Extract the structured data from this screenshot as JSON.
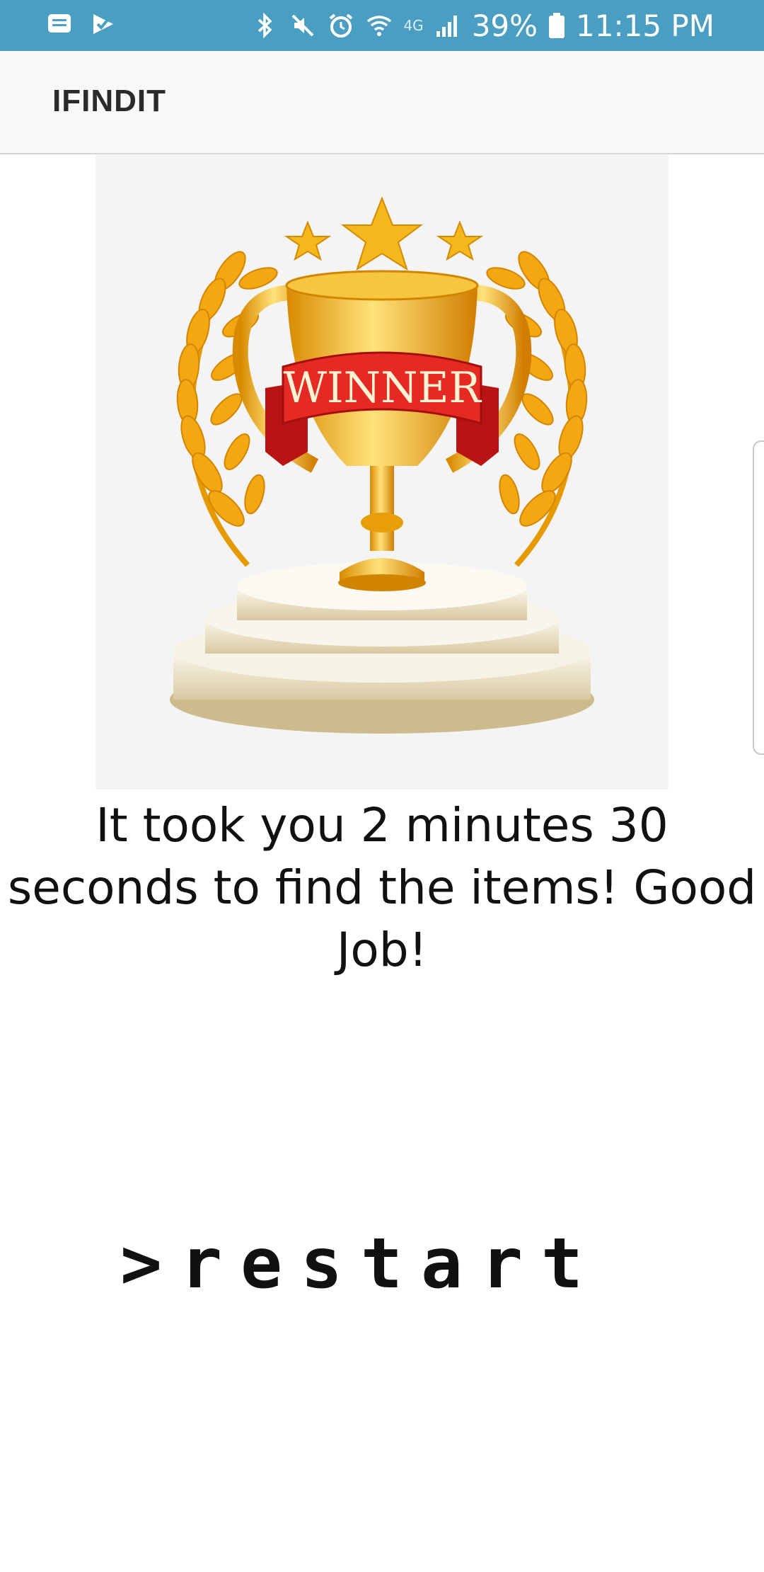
{
  "status_bar": {
    "battery": "39%",
    "time": "11:15 PM",
    "network": "4G"
  },
  "app_bar": {
    "title": "IFINDIT"
  },
  "trophy": {
    "banner_text": "WINNER"
  },
  "message": {
    "text": "It took you 2 minutes 30 seconds to find the items! Good Job!"
  },
  "restart": {
    "label": ">restart"
  },
  "colors": {
    "status_bar": "#4a9ec2",
    "app_bar": "#f8f8f8",
    "gold": "#f2b01e",
    "ribbon": "#d61f1f"
  }
}
